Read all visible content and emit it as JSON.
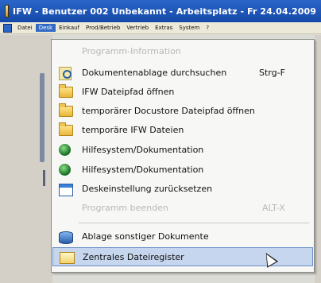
{
  "window": {
    "title": "IFW - Benutzer 002 Unbekannt - Arbeitsplatz - Fr 24.04.2009"
  },
  "menubar": {
    "items": [
      "Datei",
      "Desk",
      "Einkauf",
      "Prod/Betrieb",
      "Vertrieb",
      "Extras",
      "System",
      "?"
    ],
    "active_index": 1
  },
  "dropdown": {
    "items": [
      {
        "label": "Programm-Information",
        "shortcut": "",
        "icon": "none",
        "disabled": true
      },
      {
        "label": "Dokumentenablage durchsuchen",
        "shortcut": "Strg-F",
        "icon": "search-document-icon",
        "disabled": false
      },
      {
        "label": "IFW Dateipfad öffnen",
        "shortcut": "",
        "icon": "folder-icon",
        "disabled": false
      },
      {
        "label": "temporärer Docustore Dateipfad öffnen",
        "shortcut": "",
        "icon": "folder-icon",
        "disabled": false
      },
      {
        "label": "temporäre IFW Dateien",
        "shortcut": "",
        "icon": "folder-icon",
        "disabled": false
      },
      {
        "label": "Hilfesystem/Dokumentation",
        "shortcut": "",
        "icon": "globe-icon",
        "disabled": false
      },
      {
        "label": "Hilfesystem/Dokumentation",
        "shortcut": "",
        "icon": "globe-icon",
        "disabled": false
      },
      {
        "label": "Deskeinstellung zurücksetzen",
        "shortcut": "",
        "icon": "window-icon",
        "disabled": false
      },
      {
        "label": "Programm beenden",
        "shortcut": "ALT-X",
        "icon": "none",
        "disabled": true
      },
      {
        "label": "Ablage sonstiger Dokumente",
        "shortcut": "",
        "icon": "database-icon",
        "disabled": false
      },
      {
        "label": "Zentrales Dateiregister",
        "shortcut": "",
        "icon": "register-icon",
        "disabled": false,
        "highlighted": true
      }
    ]
  },
  "colors": {
    "titlebar": "#1f5bbf",
    "highlight": "#c6d6ee",
    "active_menu": "#316ac5"
  }
}
